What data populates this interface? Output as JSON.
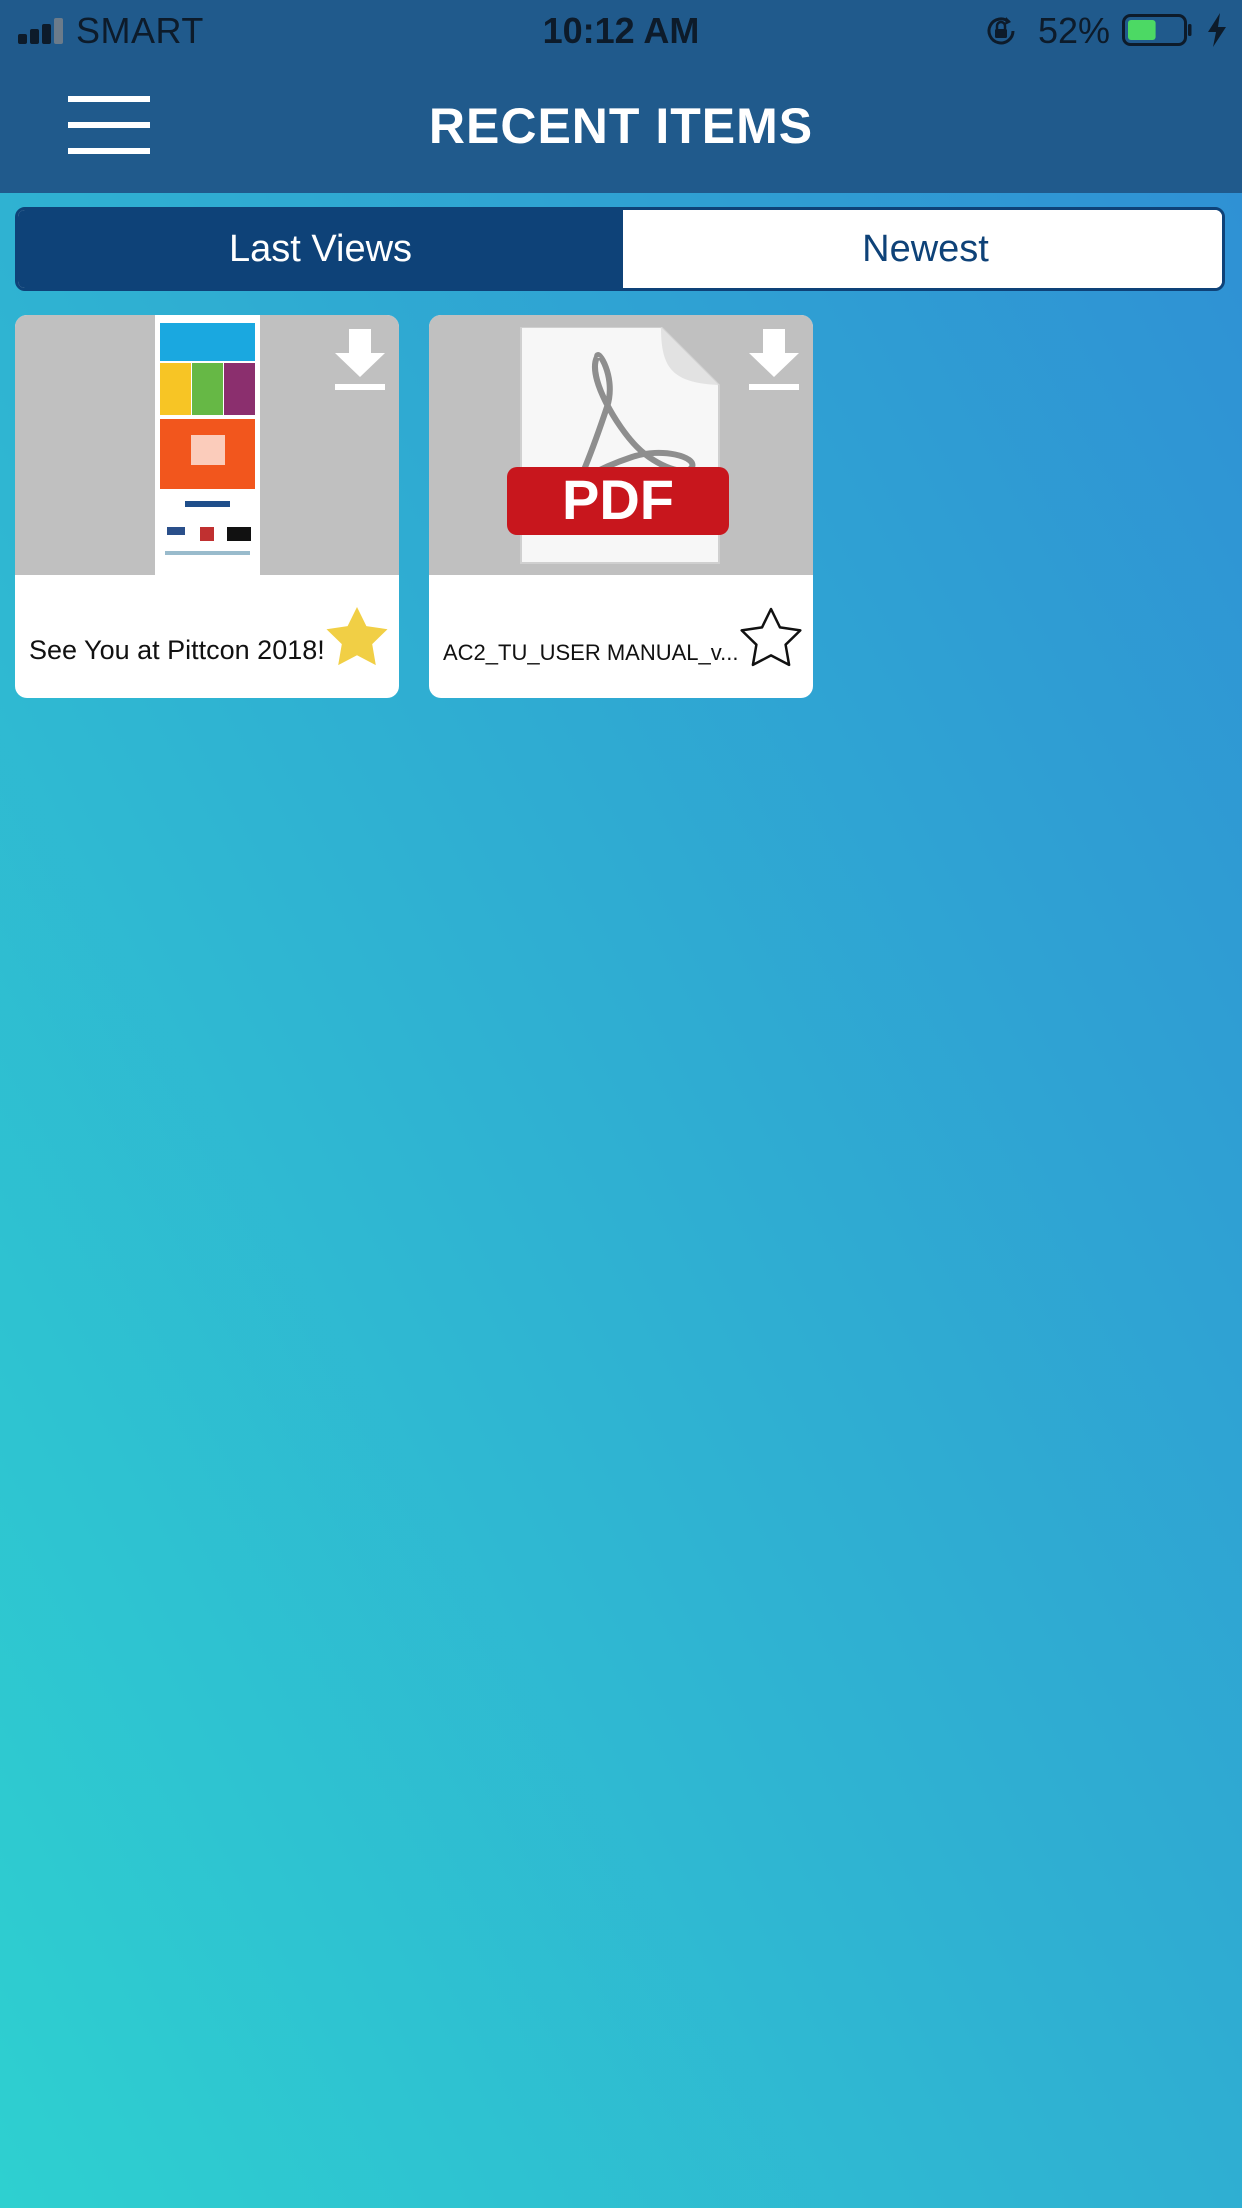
{
  "status_bar": {
    "carrier": "SMART",
    "time": "10:12 AM",
    "battery_percent": "52%",
    "battery_level": 0.52,
    "icons": [
      "signal-icon",
      "rotation-lock-icon",
      "battery-icon",
      "charging-bolt-icon"
    ]
  },
  "header": {
    "title": "RECENT ITEMS",
    "menu_icon": "hamburger-icon"
  },
  "tabs": [
    {
      "label": "Last Views",
      "active": true
    },
    {
      "label": "Newest",
      "active": false
    }
  ],
  "items": [
    {
      "title": "See You at Pittcon 2018!",
      "favorite": true,
      "thumbnail": "flyer-thumbnail",
      "download_icon": "download-icon"
    },
    {
      "title": "AC2_TU_USER MANUAL_v...",
      "favorite": false,
      "thumbnail": "pdf-icon",
      "thumbnail_label": "PDF",
      "download_icon": "download-icon"
    }
  ],
  "colors": {
    "header_bg": "#205a8c",
    "tab_active": "#0e4278",
    "star_filled": "#f1cf45",
    "pdf_red": "#c8161d"
  }
}
